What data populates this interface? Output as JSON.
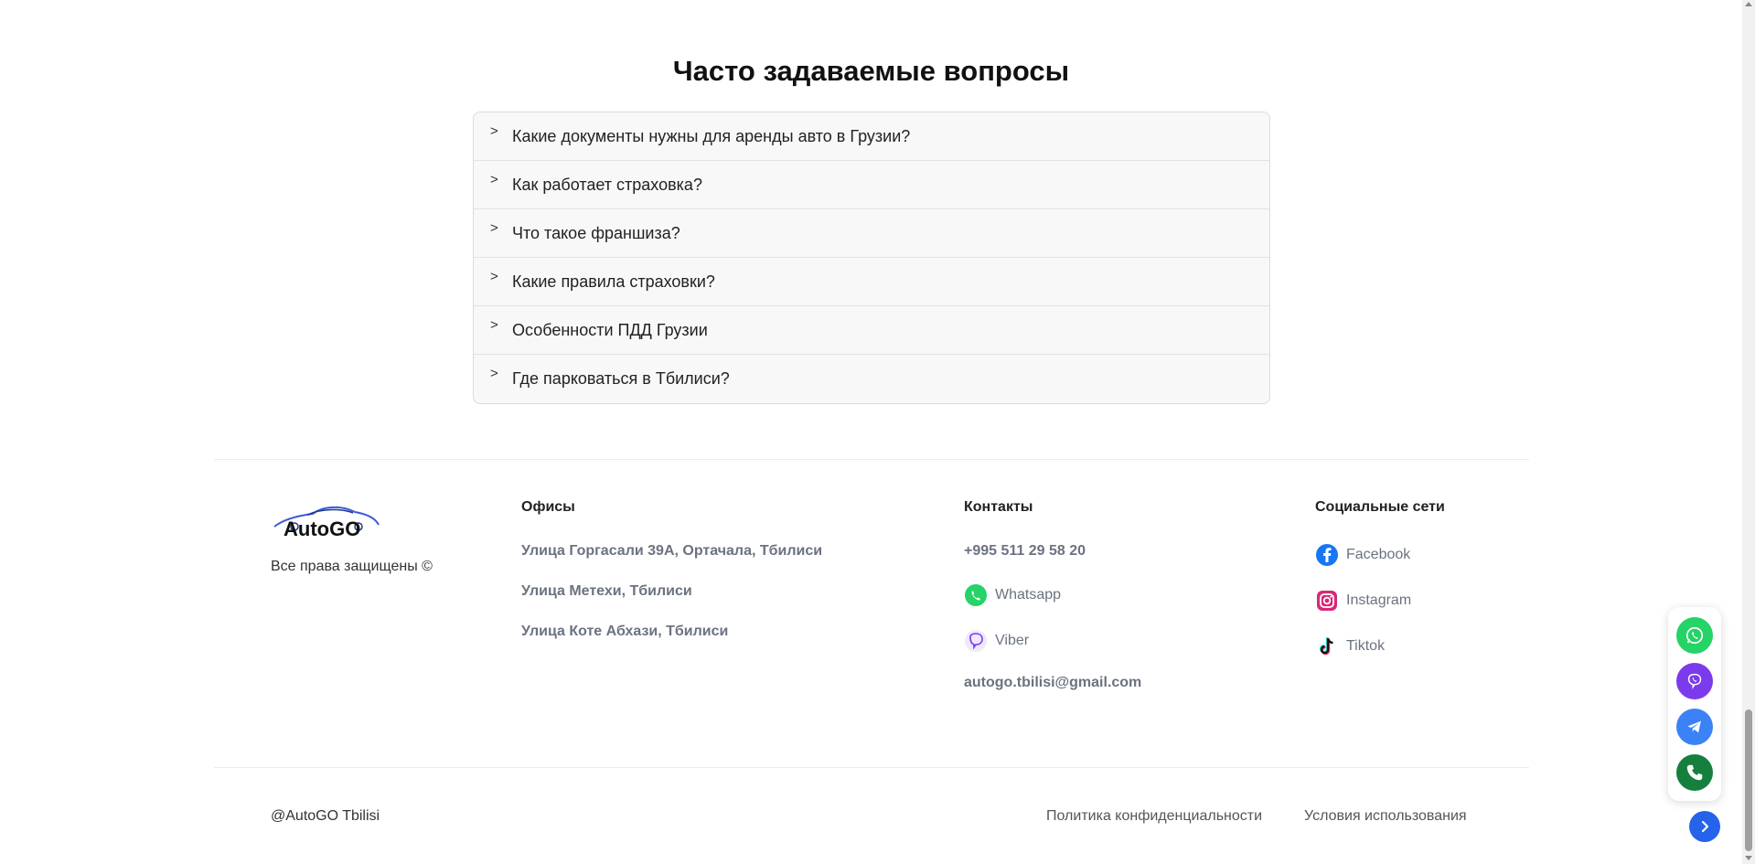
{
  "faq": {
    "title": "Часто задаваемые вопросы",
    "items": [
      {
        "question": "Какие документы нужны для аренды авто в Грузии?"
      },
      {
        "question": "Как работает страховка?"
      },
      {
        "question": "Что такое франшиза?"
      },
      {
        "question": "Какие правила страховки?"
      },
      {
        "question": "Особенности ПДД Грузии"
      },
      {
        "question": "Где парковаться в Тбилиси?"
      }
    ],
    "chevron": ">"
  },
  "footer": {
    "logo_text": "AutoGO",
    "rights": "Все права защищены ©",
    "offices": {
      "title": "Офисы",
      "lines": [
        "Улица Горгасали 39А, Ортачала, Тбилиси",
        "Улица Метехи, Тбилиси",
        "Улица Коте Абхази, Тбилиси"
      ]
    },
    "contacts": {
      "title": "Контакты",
      "phone": "+995 511 29 58 20",
      "whatsapp": "Whatsapp",
      "viber": "Viber",
      "email": "autogo.tbilisi@gmail.com"
    },
    "social": {
      "title": "Социальные сети",
      "facebook": "Facebook",
      "instagram": "Instagram",
      "tiktok": "Tiktok"
    },
    "copyright": "@AutoGO Tbilisi",
    "privacy": "Политика конфиденциальности",
    "terms": "Условия использования"
  },
  "colors": {
    "whatsapp": "#25D366",
    "viber": "#7C3AED",
    "telegram": "#3B82F6",
    "phone": "#15803D",
    "scroll_button": "#2563EB",
    "facebook": "#1877F2"
  }
}
